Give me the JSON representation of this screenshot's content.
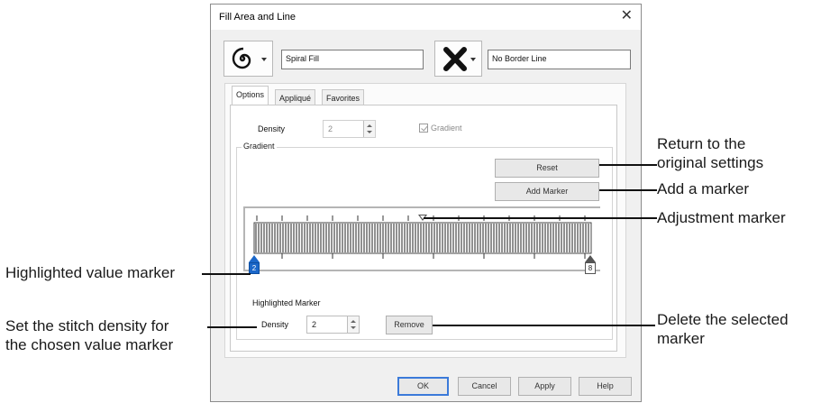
{
  "dialog": {
    "title": "Fill Area and Line",
    "close_glyph": "✕",
    "fill_icon": "spiral-icon",
    "fill_name": "Spiral Fill",
    "border_icon": "no-border-x-icon",
    "border_name": "No Border Line"
  },
  "tabs": [
    {
      "label": "Options",
      "active": true
    },
    {
      "label": "Appliqué",
      "active": false
    },
    {
      "label": "Favorites",
      "active": false
    }
  ],
  "options": {
    "density_label": "Density",
    "density_value": "2",
    "gradient_checkbox_label": "Gradient",
    "gradient_checked": true,
    "gradient_group_label": "Gradient",
    "reset_label": "Reset",
    "add_marker_label": "Add Marker",
    "highlighted_marker_label": "Highlighted Marker",
    "hm_density_label": "Density",
    "hm_density_value": "2",
    "remove_label": "Remove"
  },
  "gradient_markers": {
    "left_value": "2",
    "right_value": "8"
  },
  "footer": {
    "ok": "OK",
    "cancel": "Cancel",
    "apply": "Apply",
    "help": "Help"
  },
  "callouts": {
    "reset_line1": "Return to the",
    "reset_line2": "original settings",
    "add_marker": "Add a marker",
    "adjustment_marker": "Adjustment marker",
    "highlighted_value_marker": "Highlighted value marker",
    "set_density_line1": "Set the stitch density for",
    "set_density_line2": "the chosen value marker",
    "delete_line1": "Delete the selected",
    "delete_line2": "marker"
  },
  "colors": {
    "accent": "#1b67c9",
    "ok_border": "#3b7ad9"
  }
}
